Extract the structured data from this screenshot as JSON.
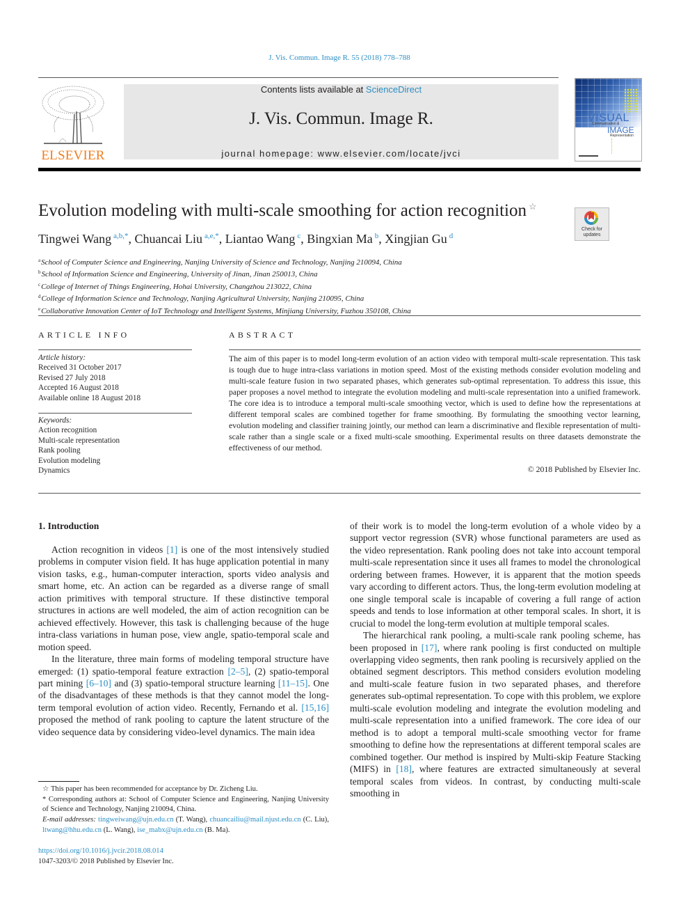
{
  "header": {
    "citation": "J. Vis. Commun. Image R. 55 (2018) 778–788",
    "publisher_logo_text": "ELSEVIER",
    "contents_prefix": "Contents lists available at ",
    "contents_link": "ScienceDirect",
    "journal_title": "J. Vis. Commun. Image R.",
    "homepage": "journal homepage: www.elsevier.com/locate/jvci",
    "cover": {
      "line1": "VISUAL",
      "line2": "Communication &",
      "line3": "IMAGE",
      "line4": "Representation"
    },
    "check_updates": {
      "line1": "Check for",
      "line2": "updates"
    }
  },
  "article": {
    "title": "Evolution modeling with multi-scale smoothing for action recognition",
    "title_mark": "☆",
    "authors": [
      {
        "name": "Tingwei Wang",
        "sup": "a,b,*"
      },
      {
        "name": "Chuancai Liu",
        "sup": "a,e,*"
      },
      {
        "name": "Liantao Wang",
        "sup": "c"
      },
      {
        "name": "Bingxian Ma",
        "sup": "b"
      },
      {
        "name": "Xingjian Gu",
        "sup": "d"
      }
    ],
    "affiliations": [
      {
        "key": "a",
        "text": "School of Computer Science and Engineering, Nanjing University of Science and Technology, Nanjing 210094, China"
      },
      {
        "key": "b",
        "text": "School of Information Science and Engineering, University of Jinan, Jinan 250013, China"
      },
      {
        "key": "c",
        "text": "College of Internet of Things Engineering, Hohai University, Changzhou 213022, China"
      },
      {
        "key": "d",
        "text": "College of Information Science and Technology, Nanjing Agricultural University, Nanjing 210095, China"
      },
      {
        "key": "e",
        "text": "Collaborative Innovation Center of IoT Technology and Intelligent Systems, Minjiang University, Fuzhou 350108, China"
      }
    ]
  },
  "article_info": {
    "heading": "ARTICLE INFO",
    "history_label": "Article history:",
    "history": [
      "Received 31 October 2017",
      "Revised 27 July 2018",
      "Accepted 16 August 2018",
      "Available online 18 August 2018"
    ],
    "keywords_label": "Keywords:",
    "keywords": [
      "Action recognition",
      "Multi-scale representation",
      "Rank pooling",
      "Evolution modeling",
      "Dynamics"
    ]
  },
  "abstract": {
    "heading": "ABSTRACT",
    "text": "The aim of this paper is to model long-term evolution of an action video with temporal multi-scale representation. This task is tough due to huge intra-class variations in motion speed. Most of the existing methods consider evolution modeling and multi-scale feature fusion in two separated phases, which generates sub-optimal representation. To address this issue, this paper proposes a novel method to integrate the evolution modeling and multi-scale representation into a unified framework. The core idea is to introduce a temporal multi-scale smoothing vector, which is used to define how the representations at different temporal scales are combined together for frame smoothing. By formulating the smoothing vector learning, evolution modeling and classifier training jointly, our method can learn a discriminative and flexible representation of multi-scale rather than a single scale or a fixed multi-scale smoothing. Experimental results on three datasets demonstrate the effectiveness of our method.",
    "copyright": "© 2018 Published by Elsevier Inc."
  },
  "body": {
    "section_heading": "1. Introduction",
    "p1": [
      "Action recognition in videos ",
      "[1]",
      " is one of the most intensively studied problems in computer vision field. It has huge application potential in many vision tasks, e.g., human-computer interaction, sports video analysis and smart home, etc. An action can be regarded as a diverse range of small action primitives with temporal structure. If these distinctive temporal structures in actions are well modeled, the aim of action recognition can be achieved effectively. However, this task is challenging because of the huge intra-class variations in human pose, view angle, spatio-temporal scale and motion speed."
    ],
    "p2": [
      "In the literature, three main forms of modeling temporal structure have emerged: (1) spatio-temporal feature extraction ",
      "[2–5]",
      ", (2) spatio-temporal part mining ",
      "[6–10]",
      " and (3) spatio-temporal structure learning ",
      "[11–15]",
      ". One of the disadvantages of these methods is that they cannot model the long-term temporal evolution of action video. Recently, Fernando et al. ",
      "[15,16]",
      " proposed the method of rank pooling to capture the latent structure of the video sequence data by considering video-level dynamics. The main idea"
    ],
    "p3": "of their work is to model the long-term evolution of a whole video by a support vector regression (SVR) whose functional parameters are used as the video representation. Rank pooling does not take into account temporal multi-scale representation since it uses all frames to model the chronological ordering between frames. However, it is apparent that the motion speeds vary according to different actors. Thus, the long-term evolution modeling at one single temporal scale is incapable of covering a full range of action speeds and tends to lose information at other temporal scales. In short, it is crucial to model the long-term evolution at multiple temporal scales.",
    "p4": [
      "The hierarchical rank pooling, a multi-scale rank pooling scheme, has been proposed in ",
      "[17]",
      ", where rank pooling is first conducted on multiple overlapping video segments, then rank pooling is recursively applied on the obtained segment descriptors. This method considers evolution modeling and multi-scale feature fusion in two separated phases, and therefore generates sub-optimal representation. To cope with this problem, we explore multi-scale evolution modeling and integrate the evolution modeling and multi-scale representation into a unified framework. The core idea of our method is to adopt a temporal multi-scale smoothing vector for frame smoothing to define how the representations at different temporal scales are combined together. Our method is inspired by Multi-skip Feature Stacking (MIFS) in ",
      "[18]",
      ", where features are extracted simultaneously at several temporal scales from videos. In contrast, by conducting multi-scale smoothing in"
    ]
  },
  "footnotes": {
    "star": "☆ This paper has been recommended for acceptance by Dr. Zicheng Liu.",
    "corresponding": "* Corresponding authors at: School of Computer Science and Engineering, Nanjing University of Science and Technology, Nanjing 210094, China.",
    "email_label": "E-mail addresses:",
    "emails": [
      {
        "addr": "tingweiwang@ujn.edu.cn",
        "who": " (T. Wang), "
      },
      {
        "addr": "chuancailiu@mail.njust.edu.cn",
        "who": " (C. Liu), "
      },
      {
        "addr": "ltwang@hhu.edu.cn",
        "who": " (L. Wang), "
      },
      {
        "addr": "ise_mabx@ujn.edu.cn",
        "who": " (B. Ma)."
      }
    ],
    "doi": "https://doi.org/10.1016/j.jvcir.2018.08.014",
    "issn": "1047-3203/© 2018 Published by Elsevier Inc."
  },
  "colors": {
    "link": "#2b8ec4",
    "elsevier_orange": "#f07e1e",
    "banner_bg": "#e7e7e7"
  }
}
